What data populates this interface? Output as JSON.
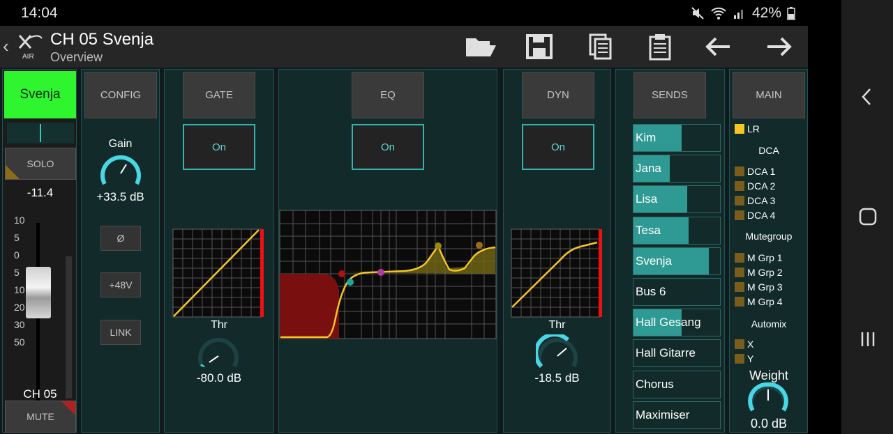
{
  "status": {
    "time": "14:04",
    "battery": "42%"
  },
  "header": {
    "title": "CH 05 Svenja",
    "subtitle": "Overview",
    "logo_text": "AIR"
  },
  "strip": {
    "name": "Svenja",
    "solo_label": "SOLO",
    "level": "-11.4",
    "scale": [
      "10",
      "5",
      "0",
      "5",
      "10",
      "20",
      "30",
      "50"
    ],
    "channel": "CH 05",
    "mute_label": "MUTE",
    "colors": {
      "name_bg": "#2ff52f"
    }
  },
  "config": {
    "title": "CONFIG",
    "gain_label": "Gain",
    "gain_value": "+33.5 dB",
    "phase_label": "Ø",
    "phantom_label": "+48V",
    "link_label": "LINK"
  },
  "gate": {
    "title": "GATE",
    "on_label": "On",
    "thr_label": "Thr",
    "thr_value": "-80.0 dB"
  },
  "eq": {
    "title": "EQ",
    "on_label": "On"
  },
  "dyn": {
    "title": "DYN",
    "on_label": "On",
    "thr_label": "Thr",
    "thr_value": "-18.5 dB"
  },
  "sends": {
    "title": "SENDS",
    "items": [
      {
        "label": "Kim",
        "level": 0.56
      },
      {
        "label": "Jana",
        "level": 0.42
      },
      {
        "label": "Lisa",
        "level": 0.62
      },
      {
        "label": "Tesa",
        "level": 0.64
      },
      {
        "label": "Svenja",
        "level": 0.87
      },
      {
        "label": "Bus 6",
        "level": 0
      },
      {
        "label": "Hall Gesang",
        "level": 0.56
      },
      {
        "label": "Hall Gitarre",
        "level": 0
      },
      {
        "label": "Chorus",
        "level": 0
      },
      {
        "label": "Maximiser",
        "level": 0
      }
    ]
  },
  "main": {
    "title": "MAIN",
    "lr_label": "LR",
    "dca_heading": "DCA",
    "dca": [
      "DCA 1",
      "DCA 2",
      "DCA 3",
      "DCA 4"
    ],
    "mutegroup_heading": "Mutegroup",
    "mutegroups": [
      "M Grp 1",
      "M Grp 2",
      "M Grp 3",
      "M Grp 4"
    ],
    "automix_heading": "Automix",
    "automix": [
      "X",
      "Y"
    ],
    "weight_label": "Weight",
    "weight_value": "0.0 dB"
  }
}
